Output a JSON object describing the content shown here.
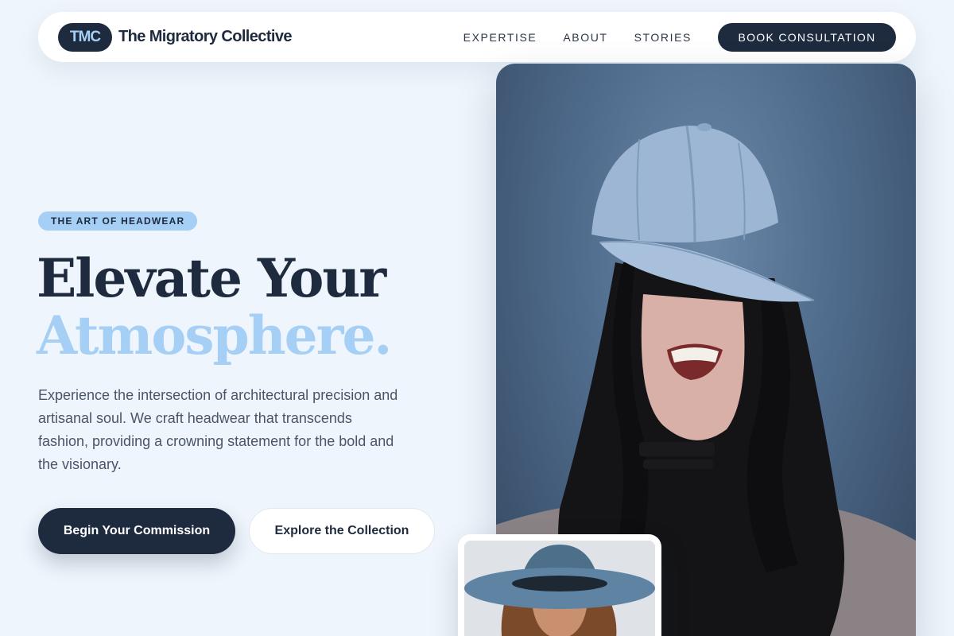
{
  "nav": {
    "logo_mark": "TMC",
    "brand_name": "The Migratory Collective",
    "links": [
      "EXPERTISE",
      "ABOUT",
      "STORIES"
    ],
    "cta": "BOOK CONSULTATION"
  },
  "hero": {
    "eyebrow": "THE ART OF HEADWEAR",
    "headline_line1": "Elevate Your",
    "headline_line2": "Atmosphere.",
    "description": "Experience the intersection of architectural precision and artisanal soul. We craft headwear that transcends fashion, providing a crowning statement for the bold and the visionary.",
    "primary_button": "Begin Your Commission",
    "secondary_button": "Explore the Collection"
  },
  "images": {
    "main_photo": "woman-in-light-blue-baseball-cap-photo",
    "thumbnail_photo": "woman-in-blue-fedora-photo"
  },
  "colors": {
    "navy": "#1e2a3e",
    "accent_blue": "#a6cff5",
    "background": "#eef5fc"
  }
}
